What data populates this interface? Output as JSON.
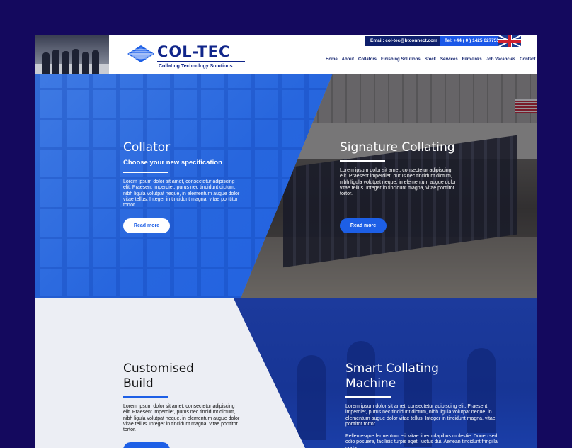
{
  "header": {
    "email": "Email: col-tec@btconnect.com",
    "tel": "Tel: +44 ( 0 ) 1425 627755",
    "logo_word": "COL-TEC",
    "logo_tagline": "Collating Technology Solutions",
    "nav": [
      "Home",
      "About",
      "Collators",
      "Finishing Solutions",
      "Stock",
      "Services",
      "Film-links",
      "Job Vacancies",
      "Contact"
    ]
  },
  "panels": {
    "collator": {
      "title": "Collator",
      "subtitle": "Choose your  new specification",
      "body": "Lorem ipsum dolor sit amet, consectetur adipiscing elit. Praesent imperdiet, purus nec tincidunt dictum, nibh ligula volutpat neque, in elementum augue dolor vitae tellus. Integer in tincidunt magna, vitae porttitor tortor.",
      "button": "Read more"
    },
    "signature": {
      "title": "Signature Collating",
      "body": "Lorem ipsum dolor sit amet, consectetur adipiscing elit. Praesent imperdiet, purus nec tincidunt dictum, nibh ligula volutpat neque, in elementum augue dolor vitae tellus. Integer in tincidunt magna, vitae porttitor tortor.",
      "button": "Read more"
    },
    "customised": {
      "title_line1": "Customised",
      "title_line2": "Build",
      "body": "Lorem ipsum dolor sit amet, consectetur adipiscing elit. Praesent imperdiet, purus nec tincidunt dictum, nibh ligula volutpat neque, in elementum augue dolor vitae tellus. Integer in tincidunt magna, vitae porttitor tortor."
    },
    "smart": {
      "title_line1": "Smart Collating",
      "title_line2": "Machine",
      "body": "Lorem ipsum dolor sit amet, consectetur adipiscing elit. Praesent imperdiet, purus nec tincidunt dictum, nibh ligula volutpat neque, in elementum augue dolor vitae tellus. Integer in tincidunt magna, vitae porttitor tortor.",
      "body2": "Pellentesque fermentum elit vitae libero dapibus molestie. Donec sed odio posuere, facilisis turpis eget, luctus dui. Aenean tincidunt fringilla porta."
    }
  },
  "colors": {
    "brand_dark": "#0d1e6b",
    "brand_blue": "#1d5fe6",
    "page_bg": "#14095e"
  }
}
